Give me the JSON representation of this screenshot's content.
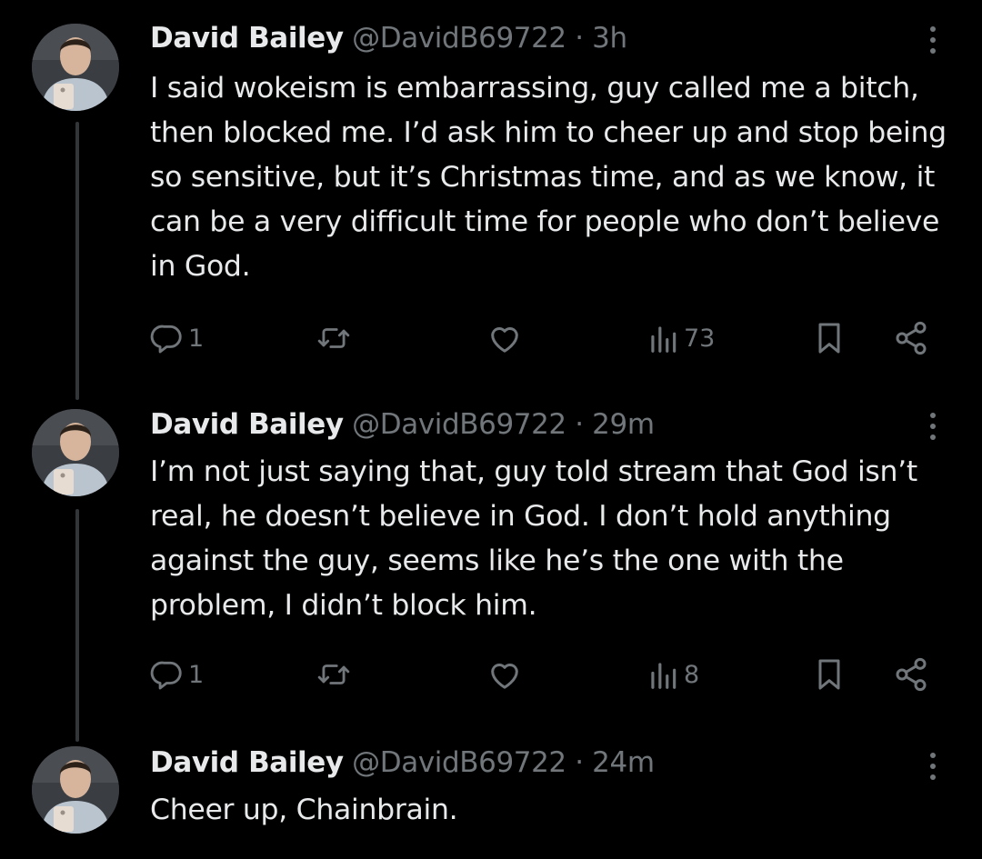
{
  "tweets": [
    {
      "author_name": "David Bailey",
      "handle": "@DavidB69722",
      "separator": "·",
      "time": "3h",
      "text": "I said wokeism is embarrassing, guy called me a bitch, then blocked me. I’d ask him to cheer up and stop being so sensitive, but it’s Christmas time, and as we know, it can be a very difficult time for people who don’t believe in God.",
      "replies": "1",
      "views": "73"
    },
    {
      "author_name": "David Bailey",
      "handle": "@DavidB69722",
      "separator": "·",
      "time": "29m",
      "text": "I’m not just saying that, guy told stream that God isn’t real, he doesn’t believe in God. I don’t hold anything against the guy, seems like he’s the one with the problem, I didn’t block him.",
      "replies": "1",
      "views": "8"
    },
    {
      "author_name": "David Bailey",
      "handle": "@DavidB69722",
      "separator": "·",
      "time": "24m",
      "text": "Cheer up, Chainbrain."
    }
  ],
  "colors": {
    "background": "#000000",
    "primary_text": "#e7e9ea",
    "secondary_text": "#71767b",
    "thread_line": "#333639"
  },
  "icons": {
    "reply": "reply-icon",
    "repost": "repost-icon",
    "like": "like-icon",
    "views": "views-icon",
    "bookmark": "bookmark-icon",
    "share": "share-icon",
    "more": "more-icon"
  }
}
